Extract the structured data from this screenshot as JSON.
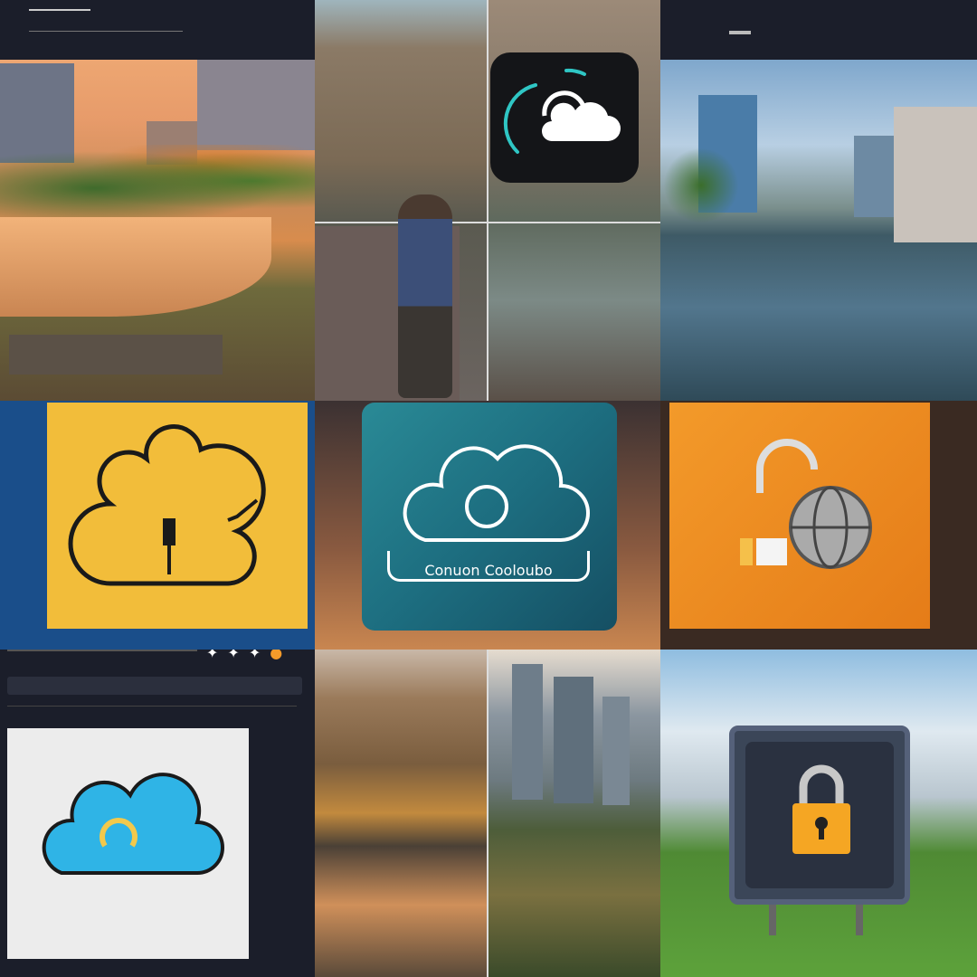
{
  "tiles": {
    "cloud_card_label": "Conuon Cooloubo"
  },
  "colors": {
    "yellow_card": "#f2bd3a",
    "teal_card": "#1d6e80",
    "orange_card": "#f08a22",
    "dark_ui": "#1b1e2a",
    "lock_gold": "#f5a623"
  }
}
